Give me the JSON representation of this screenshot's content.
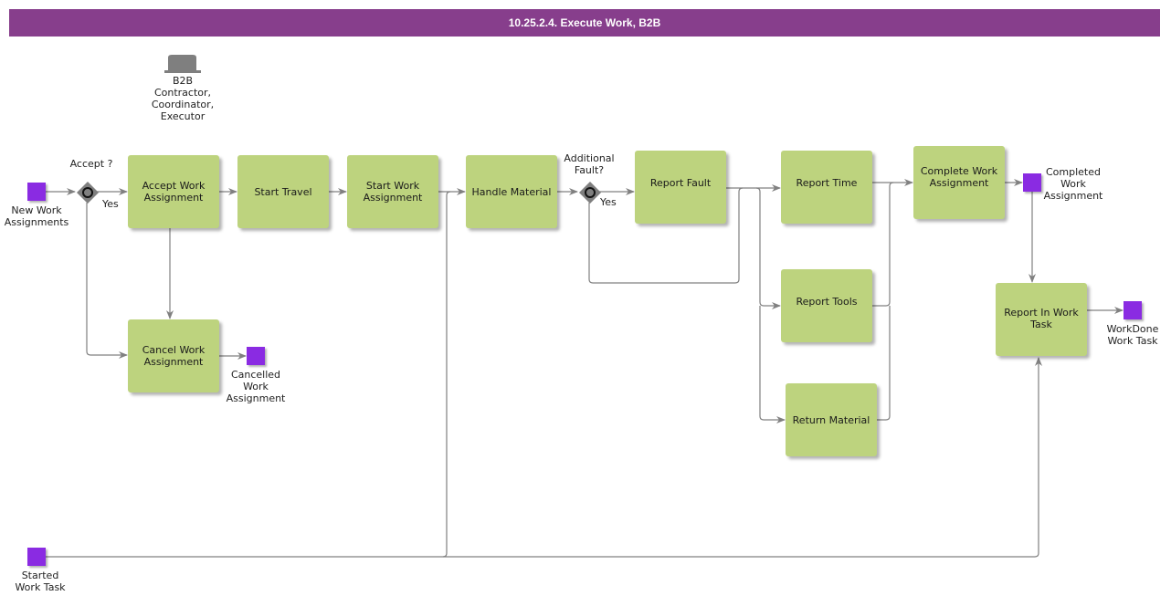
{
  "title": "10.25.2.4. Execute Work, B2B",
  "colors": {
    "title_bar": "#873e8c",
    "task_fill": "#bdd37e",
    "event_fill": "#8a2be2",
    "gateway_fill": "#7f7f7f",
    "edge": "#808080"
  },
  "role": {
    "icon": "role-hat-icon",
    "lines": [
      "B2B",
      "Contractor,",
      "Coordinator,",
      "Executor"
    ]
  },
  "events": {
    "new_work": [
      "New Work",
      "Assignments"
    ],
    "cancelled": [
      "Cancelled",
      "Work",
      "Assignment"
    ],
    "completed": [
      "Completed",
      "Work",
      "Assignment"
    ],
    "workdone": [
      "WorkDone",
      "Work Task"
    ],
    "started": [
      "Started",
      "Work Task"
    ]
  },
  "gateways": {
    "accept": {
      "label": "Accept ?",
      "yes": "Yes"
    },
    "fault": {
      "label_lines": [
        "Additional",
        "Fault?"
      ],
      "yes": "Yes"
    }
  },
  "tasks": {
    "accept_work": [
      "Accept Work",
      "Assignment"
    ],
    "start_travel": [
      "Start Travel"
    ],
    "start_work": [
      "Start Work",
      "Assignment"
    ],
    "handle_material": [
      "Handle Material"
    ],
    "report_fault": [
      "Report Fault"
    ],
    "report_time": [
      "Report Time"
    ],
    "report_tools": [
      "Report Tools"
    ],
    "return_material": [
      "Return Material"
    ],
    "complete_work": [
      "Complete Work",
      "Assignment"
    ],
    "report_in_work": [
      "Report In Work",
      "Task"
    ],
    "cancel_work": [
      "Cancel Work",
      "Assignment"
    ]
  }
}
